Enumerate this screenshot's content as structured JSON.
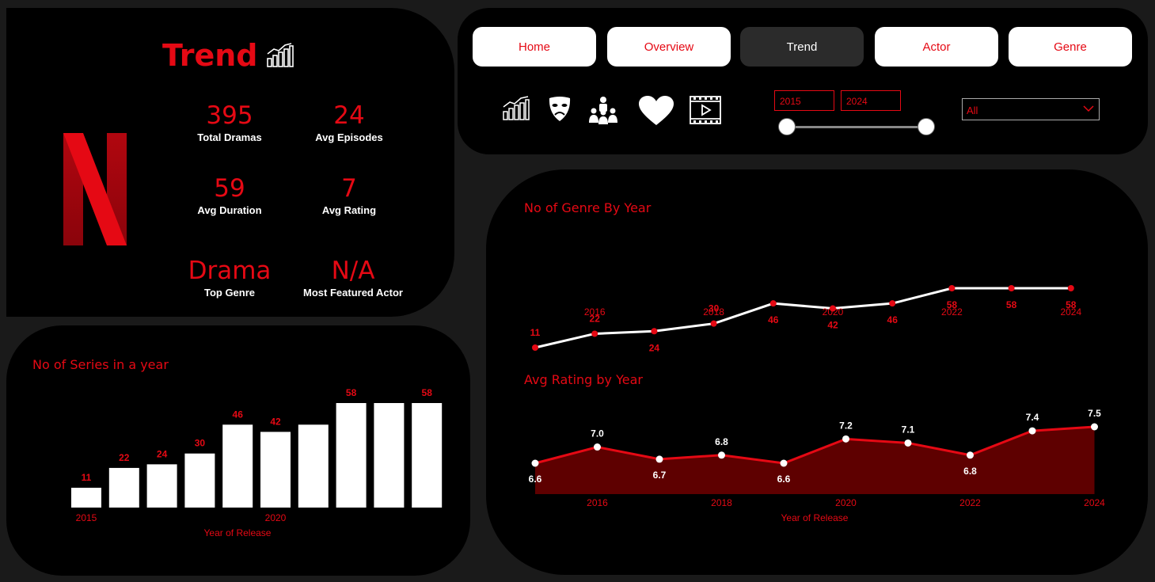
{
  "page": {
    "title": "Trend"
  },
  "kpis": [
    {
      "value": "395",
      "label": "Total Dramas"
    },
    {
      "value": "24",
      "label": "Avg Episodes"
    },
    {
      "value": "59",
      "label": "Avg Duration"
    },
    {
      "value": "7",
      "label": "Avg Rating"
    },
    {
      "value": "Drama",
      "label": "Top Genre"
    },
    {
      "value": "N/A",
      "label": "Most Featured Actor"
    }
  ],
  "nav": {
    "buttons": [
      {
        "label": "Home"
      },
      {
        "label": "Overview"
      },
      {
        "label": "Trend",
        "active": true
      },
      {
        "label": "Actor"
      },
      {
        "label": "Genre"
      }
    ],
    "icons": [
      "trend-chart-icon",
      "drama-mask-icon",
      "audience-icon",
      "heart-icon",
      "video-play-icon"
    ]
  },
  "filters": {
    "year_start": "2015",
    "year_end": "2024",
    "genre_selected": "All"
  },
  "colors": {
    "accent": "#e50914",
    "panel": "#000000",
    "background": "#1a1a1a",
    "area_fill": "#5e0000"
  },
  "chart_data": [
    {
      "type": "bar",
      "title": "No of Series in a year",
      "xlabel": "Year of Release",
      "ylabel": "",
      "x": [
        2015,
        2016,
        2017,
        2018,
        2019,
        2020,
        2021,
        2022,
        2023,
        2024
      ],
      "values": [
        11,
        22,
        24,
        30,
        46,
        42,
        46,
        58,
        58,
        58
      ],
      "shown_value_labels": [
        "11",
        "22",
        "24",
        "30",
        "46",
        "42",
        "",
        "58",
        "",
        "58"
      ],
      "x_ticks": [
        "2015",
        "2020"
      ],
      "ylim": [
        0,
        58
      ]
    },
    {
      "type": "line",
      "title": "No of Genre By Year",
      "xlabel": "",
      "ylabel": "",
      "x": [
        2015,
        2016,
        2017,
        2018,
        2019,
        2020,
        2021,
        2022,
        2023,
        2024
      ],
      "values": [
        11,
        22,
        24,
        30,
        46,
        42,
        46,
        58,
        58,
        58
      ],
      "x_ticks": [
        "2016",
        "2018",
        "2020",
        "2022",
        "2024"
      ],
      "ylim": [
        11,
        58
      ]
    },
    {
      "type": "area",
      "title": "Avg Rating by Year",
      "xlabel": "Year of Release",
      "ylabel": "",
      "x": [
        2015,
        2016,
        2017,
        2018,
        2019,
        2020,
        2021,
        2022,
        2023,
        2024
      ],
      "values": [
        6.6,
        7.0,
        6.7,
        6.8,
        6.6,
        7.2,
        7.1,
        6.8,
        7.4,
        7.5
      ],
      "value_labels": [
        "6.6",
        "7.0",
        "6.7",
        "6.8",
        "6.6",
        "7.2",
        "7.1",
        "6.8",
        "7.4",
        "7.5"
      ],
      "x_ticks": [
        "2016",
        "2018",
        "2020",
        "2022",
        "2024"
      ],
      "ylim": [
        6.6,
        7.5
      ]
    }
  ]
}
